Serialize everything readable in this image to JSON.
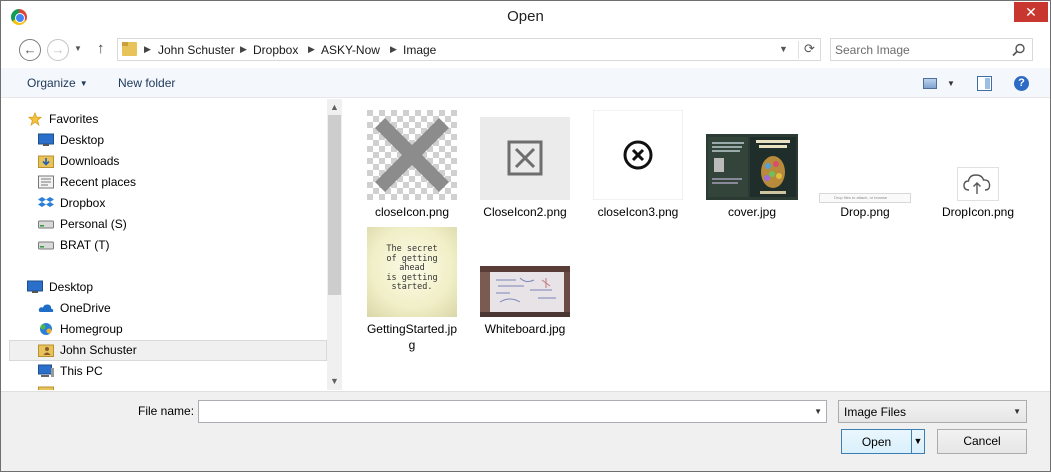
{
  "window": {
    "title": "Open",
    "close_label": "✕"
  },
  "nav": {
    "back_glyph": "←",
    "forward_glyph": "→",
    "up_glyph": "↑",
    "breadcrumbs": [
      "John Schuster",
      "Dropbox",
      "ASKY-Now",
      "Image"
    ],
    "search_placeholder": "Search Image"
  },
  "toolbar": {
    "organize_label": "Organize",
    "new_folder_label": "New folder",
    "help_label": "?"
  },
  "sidebar": {
    "items": [
      {
        "label": "Favorites",
        "icon": "star-icon"
      },
      {
        "label": "Desktop",
        "icon": "desktop-icon"
      },
      {
        "label": "Downloads",
        "icon": "downloads-icon"
      },
      {
        "label": "Recent places",
        "icon": "recent-places-icon"
      },
      {
        "label": "Dropbox",
        "icon": "dropbox-icon"
      },
      {
        "label": "Personal (S)",
        "icon": "drive-icon"
      },
      {
        "label": "BRAT (T)",
        "icon": "drive-icon"
      },
      {
        "label": "Desktop",
        "icon": "desktop-icon"
      },
      {
        "label": "OneDrive",
        "icon": "onedrive-icon"
      },
      {
        "label": "Homegroup",
        "icon": "homegroup-icon"
      },
      {
        "label": "John Schuster",
        "icon": "user-folder-icon",
        "selected": true
      },
      {
        "label": "This PC",
        "icon": "computer-icon"
      }
    ]
  },
  "files": [
    {
      "name": "closeIcon.png",
      "thumb": "close-x-transparent"
    },
    {
      "name": "CloseIcon2.png",
      "thumb": "close-box"
    },
    {
      "name": "closeIcon3.png",
      "thumb": "close-circle"
    },
    {
      "name": "cover.jpg",
      "thumb": "book-cover"
    },
    {
      "name": "Drop.png",
      "thumb": "drop-bar",
      "thumb_text": "Drop files to attach, or browse"
    },
    {
      "name": "DropIcon.png",
      "thumb": "cloud-upload"
    },
    {
      "name": "GettingStarted.jpg",
      "name_line1": "GettingStarted.jp",
      "name_line2": "g",
      "thumb": "note",
      "thumb_text": "The secret\nof getting\nahead\nis getting\nstarted."
    },
    {
      "name": "Whiteboard.jpg",
      "thumb": "whiteboard-photo"
    }
  ],
  "footer": {
    "file_name_label": "File name:",
    "file_name_value": "",
    "filter_value": "Image Files",
    "open_label": "Open",
    "cancel_label": "Cancel"
  },
  "colors": {
    "accent": "#2d6bc4",
    "close": "#c7372f",
    "selection": "#f0f0f0"
  }
}
